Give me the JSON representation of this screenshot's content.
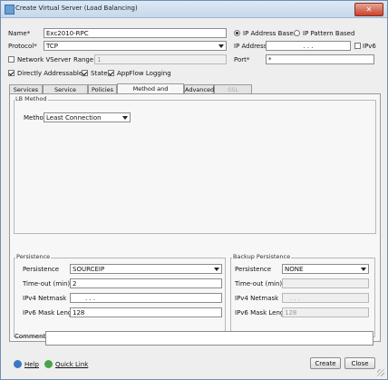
{
  "window": {
    "title": "Create Virtual Server (Load Balancing)",
    "close_glyph": "✕"
  },
  "top_form": {
    "name_label": "Name*",
    "name_value": "Exc2010-RPC",
    "protocol_label": "Protocol*",
    "protocol_value": "TCP",
    "network_vserver_label": "Network VServer",
    "network_vserver_checked": false,
    "range_label": "Range",
    "range_value": "1",
    "directly_addressable_label": "Directly Addressable",
    "directly_addressable_checked": true,
    "state_label": "State",
    "state_checked": true,
    "appflow_label": "AppFlow Logging",
    "appflow_checked": true,
    "ip_address_based_label": "IP Address Based",
    "ip_pattern_based_label": "IP Pattern Based",
    "selected_mode": "ip_address_based",
    "ip_address_label": "IP Address*",
    "ip_address_value": ".   .   .",
    "ipv6_label": "IPv6",
    "ipv6_checked": false,
    "port_label": "Port*",
    "port_value": "*"
  },
  "tabs": [
    {
      "label": "Services",
      "active": false,
      "disabled": false
    },
    {
      "label": "Service Groups",
      "active": false,
      "disabled": false
    },
    {
      "label": "Policies",
      "active": false,
      "disabled": false
    },
    {
      "label": "Method and Persistence",
      "active": true,
      "disabled": false
    },
    {
      "label": "Advanced",
      "active": false,
      "disabled": false
    },
    {
      "label": "SSL Settings",
      "active": false,
      "disabled": true
    }
  ],
  "lb_method": {
    "group_title": "LB Method",
    "method_label": "Method",
    "method_value": "Least Connection"
  },
  "persistence": {
    "group_title": "Persistence",
    "persistence_label": "Persistence",
    "persistence_value": "SOURCEIP",
    "timeout_label": "Time-out (min)",
    "timeout_value": "2",
    "ipv4_netmask_label": "IPv4 Netmask",
    "ipv4_netmask_value": ".   .   .",
    "ipv6_mask_label": "IPv6 Mask Length",
    "ipv6_mask_value": "128"
  },
  "backup_persistence": {
    "group_title": "Backup Persistence",
    "persistence_label": "Persistence",
    "persistence_value": "NONE",
    "timeout_label": "Time-out (min)",
    "timeout_value": "",
    "ipv4_netmask_label": "IPv4 Netmask",
    "ipv4_netmask_value": ".   .   .",
    "ipv6_mask_label": "IPv6 Mask Length",
    "ipv6_mask_value": "128"
  },
  "comments": {
    "label": "Comments",
    "value": ""
  },
  "footer": {
    "help_label": "Help",
    "quick_link_label": "Quick Link",
    "create_label": "Create",
    "close_label": "Close"
  },
  "icons": {
    "help": "help-icon",
    "quick_link": "quick-link-icon",
    "app": "window-app-icon"
  }
}
